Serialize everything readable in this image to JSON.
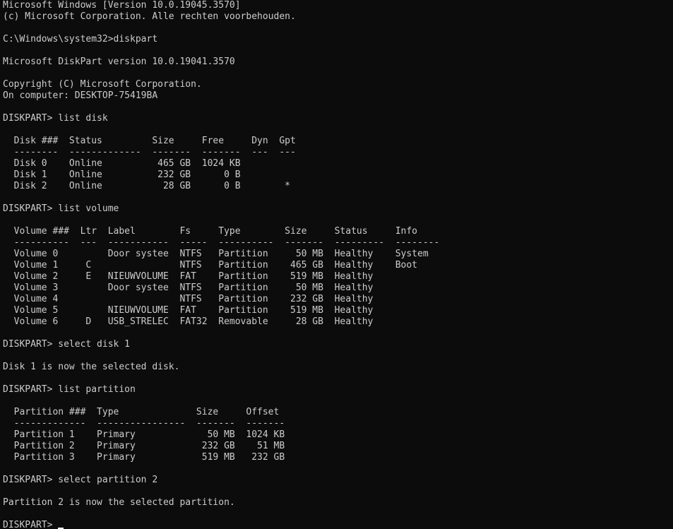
{
  "colors": {
    "background": "#0c0c0c",
    "foreground": "#cccccc",
    "cursor": "#ffffff"
  },
  "lines": [
    "Microsoft Windows [Version 10.0.19045.3570]",
    "(c) Microsoft Corporation. Alle rechten voorbehouden.",
    "",
    "C:\\Windows\\system32>diskpart",
    "",
    "Microsoft DiskPart version 10.0.19041.3570",
    "",
    "Copyright (C) Microsoft Corporation.",
    "On computer: DESKTOP-75419BA",
    "",
    "DISKPART> list disk",
    "",
    "  Disk ###  Status         Size     Free     Dyn  Gpt",
    "  --------  -------------  -------  -------  ---  ---",
    "  Disk 0    Online          465 GB  1024 KB",
    "  Disk 1    Online          232 GB      0 B",
    "  Disk 2    Online           28 GB      0 B        *",
    "",
    "DISKPART> list volume",
    "",
    "  Volume ###  Ltr  Label        Fs     Type        Size     Status     Info",
    "  ----------  ---  -----------  -----  ----------  -------  ---------  --------",
    "  Volume 0         Door systee  NTFS   Partition     50 MB  Healthy    System",
    "  Volume 1     C                NTFS   Partition    465 GB  Healthy    Boot",
    "  Volume 2     E   NIEUWVOLUME  FAT    Partition    519 MB  Healthy",
    "  Volume 3         Door systee  NTFS   Partition     50 MB  Healthy",
    "  Volume 4                      NTFS   Partition    232 GB  Healthy",
    "  Volume 5         NIEUWVOLUME  FAT    Partition    519 MB  Healthy",
    "  Volume 6     D   USB_STRELEC  FAT32  Removable     28 GB  Healthy",
    "",
    "DISKPART> select disk 1",
    "",
    "Disk 1 is now the selected disk.",
    "",
    "DISKPART> list partition",
    "",
    "  Partition ###  Type              Size     Offset",
    "  -------------  ----------------  -------  -------",
    "  Partition 1    Primary             50 MB  1024 KB",
    "  Partition 2    Primary            232 GB    51 MB",
    "  Partition 3    Primary            519 MB   232 GB",
    "",
    "DISKPART> select partition 2",
    "",
    "Partition 2 is now the selected partition.",
    ""
  ],
  "prompt": "DISKPART> "
}
